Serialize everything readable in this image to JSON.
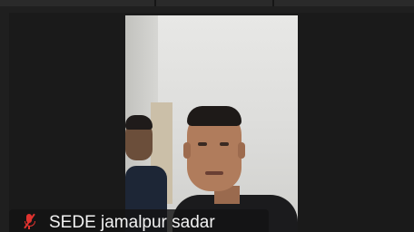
{
  "participant": {
    "name": "SEDE jamalpur sadar",
    "mic_status_icon": "mic-muted-icon",
    "mic_status_color": "#e0332f"
  }
}
